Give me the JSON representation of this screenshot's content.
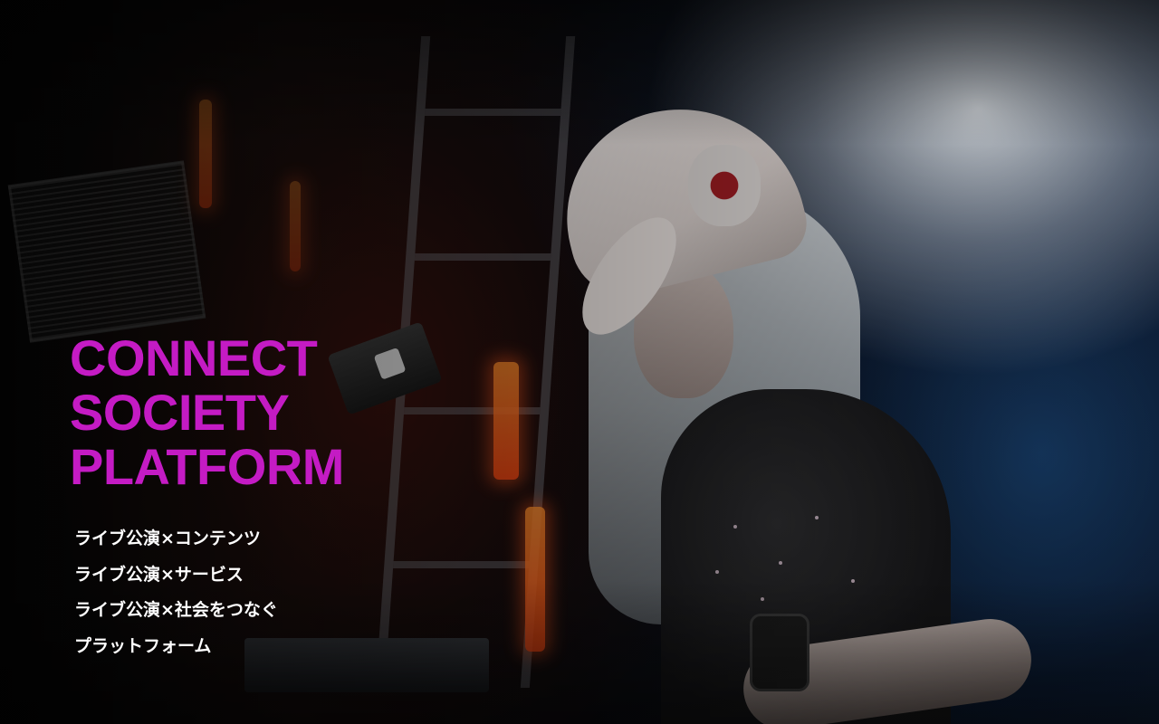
{
  "hero": {
    "headline": [
      "CONNECT",
      "SOCIETY",
      "PLATFORM"
    ],
    "tagline": [
      "ライブ公演×コンテンツ",
      "ライブ公演×サービス",
      "ライブ公演×社会をつなぐ",
      "プラットフォーム"
    ],
    "background_image": "dj-performer-with-headphones-and-white-cap",
    "headline_color": "#c41bc4",
    "tagline_color": "#ffffff"
  }
}
